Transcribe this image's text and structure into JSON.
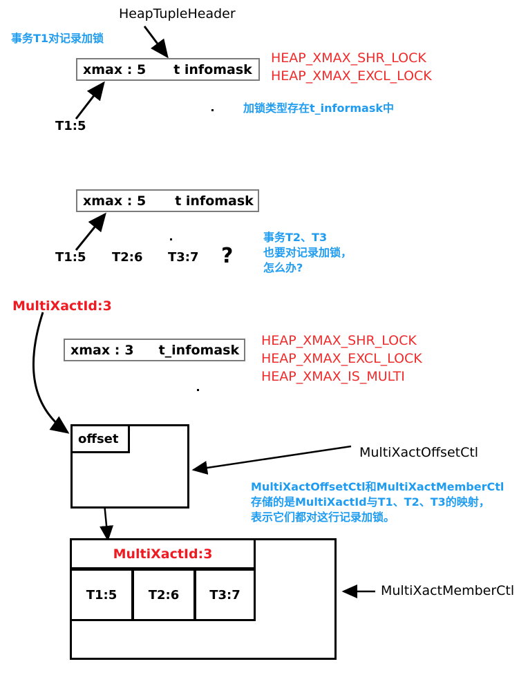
{
  "diagram": {
    "title_label": "HeapTupleHeader",
    "section1": {
      "note_blue": "事务T1对记录加锁",
      "box": {
        "xmax_label": "xmax : 5",
        "xmax_key": "xmax :",
        "xmax_value": "5",
        "infomask_label": "t  infomask"
      },
      "txn_label": "T1:5",
      "flags": [
        "HEAP_XMAX_SHR_LOCK",
        "HEAP_XMAX_EXCL_LOCK"
      ],
      "note_blue2": "加锁类型存在t_informask中"
    },
    "section2": {
      "box": {
        "xmax_label": "xmax : 5",
        "xmax_key": "xmax :",
        "xmax_value": "5",
        "infomask_label": "t  infomask"
      },
      "txn_labels": [
        "T1:5",
        "T2:6",
        "T3:7"
      ],
      "question_mark": "?",
      "note_blue": "事务T2、T3\n也要对记录加锁，\n怎么办?"
    },
    "section3": {
      "multixact_label": "MultiXactId:3",
      "box": {
        "xmax_key": "xmax :",
        "xmax_value": "3",
        "infomask_label": "t_infomask"
      },
      "flags": [
        "HEAP_XMAX_SHR_LOCK",
        "HEAP_XMAX_EXCL_LOCK",
        "HEAP_XMAX_IS_MULTI"
      ],
      "offset_box": {
        "cell_label": "offset"
      },
      "offset_ctl_label": "MultiXactOffsetCtl",
      "note_blue": "MultiXactOffsetCtl和MultiXactMemberCtl\n存储的是MultiXactId与T1、T2、T3的映射，\n表示它们都对这行记录加锁。",
      "member_table": {
        "header": "MultiXactId:3",
        "cells": [
          "T1:5",
          "T2:6",
          "T3:7"
        ]
      },
      "member_ctl_label": "MultiXactMemberCtl"
    },
    "colors": {
      "red": "#ee1c22",
      "blue": "#1f9cf0",
      "black": "#000000",
      "box_border_gray": "#7b7b7b"
    }
  }
}
